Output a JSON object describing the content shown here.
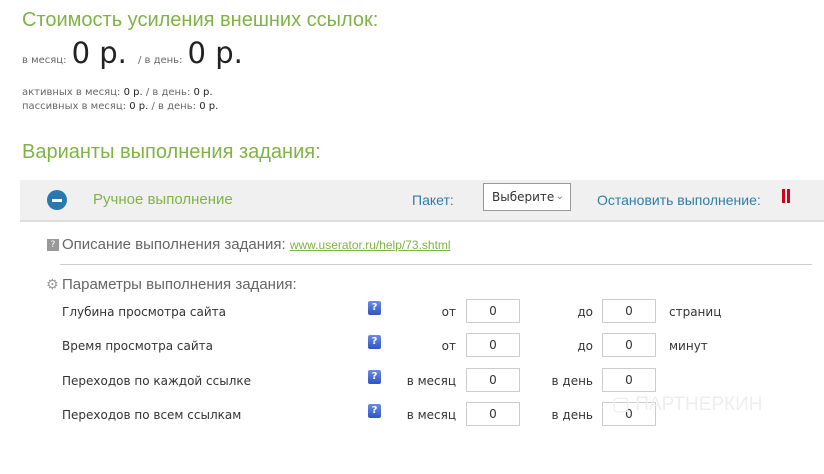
{
  "cost": {
    "title": "Стоимость усиления внешних ссылок:",
    "month_label": "в месяц:",
    "month_value": "0 р.",
    "day_label": "/ в день:",
    "day_value": "0 р.",
    "active": "активных в месяц:",
    "active_month": "0 р.",
    "active_day_label": "/ в день:",
    "active_day": "0 р.",
    "passive": "пассивных в месяц:",
    "passive_month": "0 р.",
    "passive_day_label": "/ в день:",
    "passive_day": "0 р."
  },
  "variants": {
    "title": "Варианты выполнения задания:",
    "mode": "Ручное выполнение",
    "package_label": "Пакет:",
    "package_select": "Выберите",
    "stop_label": "Остановить выполнение:"
  },
  "description": {
    "label": "Описание выполнения задания:",
    "link": "www.userator.ru/help/73.shtml"
  },
  "params": {
    "title": "Параметры выполнения задания:",
    "rows": [
      {
        "label": "Глубина просмотра сайта",
        "from_label": "от",
        "from": "0",
        "to_label": "до",
        "to": "0",
        "unit": "страниц"
      },
      {
        "label": "Время просмотра сайта",
        "from_label": "от",
        "from": "0",
        "to_label": "до",
        "to": "0",
        "unit": "минут"
      },
      {
        "label": "Переходов по каждой ссылке",
        "from_label": "в месяц",
        "from": "0",
        "to_label": "в день",
        "to": "0",
        "unit": ""
      },
      {
        "label": "Переходов по всем ссылкам",
        "from_label": "в месяц",
        "from": "0",
        "to_label": "в день",
        "to": "0",
        "unit": ""
      }
    ]
  },
  "watermark": "ПАРТНЕРКИН",
  "colors": {
    "green": "#7fb347",
    "blue": "#2e7ea6",
    "red": "#d0021b"
  }
}
